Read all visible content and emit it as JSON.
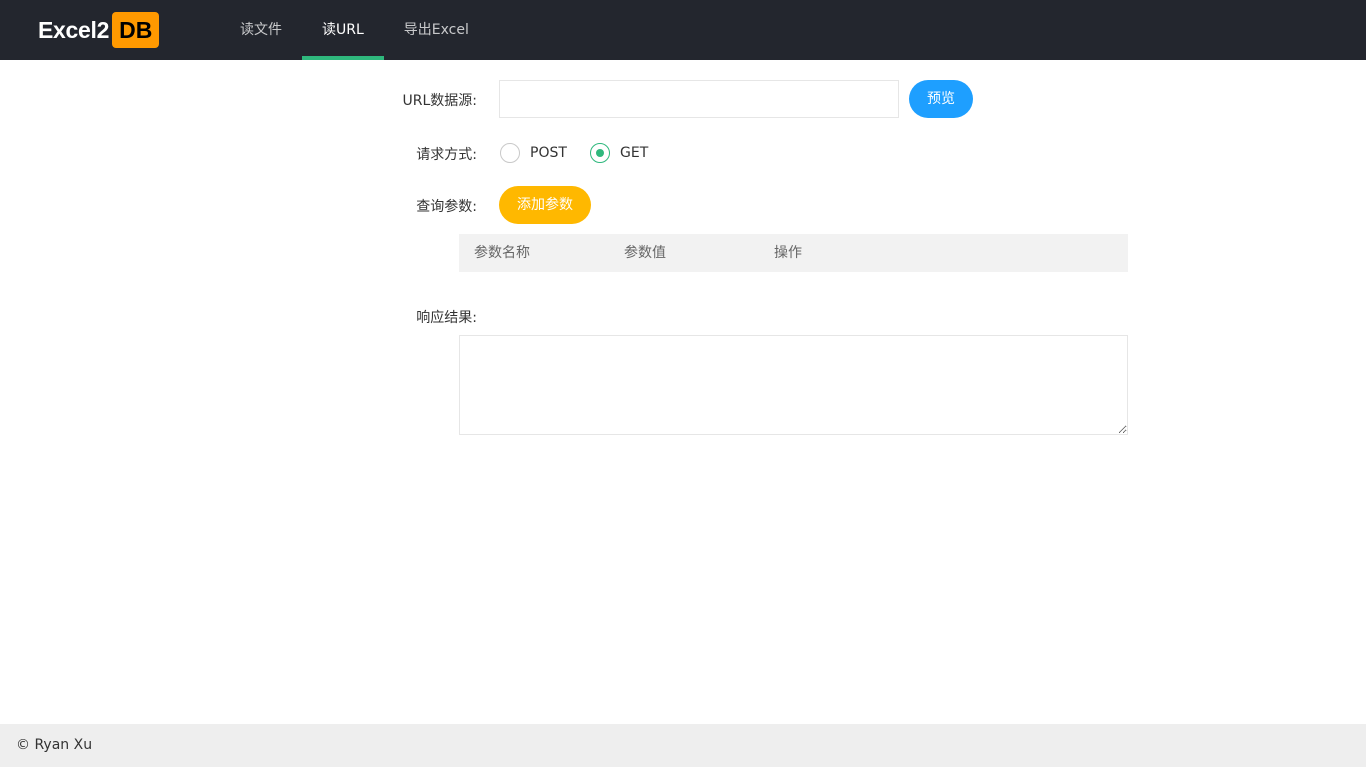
{
  "header": {
    "logo_text": "Excel2",
    "logo_badge": "DB",
    "nav": [
      {
        "label": "读文件",
        "active": false
      },
      {
        "label": "读URL",
        "active": true
      },
      {
        "label": "导出Excel",
        "active": false
      }
    ]
  },
  "form": {
    "url_label": "URL数据源:",
    "url_value": "",
    "preview_button": "预览",
    "method_label": "请求方式:",
    "methods": [
      {
        "label": "POST",
        "checked": false
      },
      {
        "label": "GET",
        "checked": true
      }
    ],
    "params_label": "查询参数:",
    "add_param_button": "添加参数",
    "table_headers": [
      "参数名称",
      "参数值",
      "操作"
    ],
    "result_label": "响应结果:",
    "result_value": ""
  },
  "footer": {
    "text": "© Ryan Xu"
  },
  "colors": {
    "header_bg": "#23262e",
    "accent_green": "#2fb87d",
    "preview_blue": "#1e9fff",
    "add_orange": "#ffb800",
    "logo_orange": "#ff9900"
  }
}
